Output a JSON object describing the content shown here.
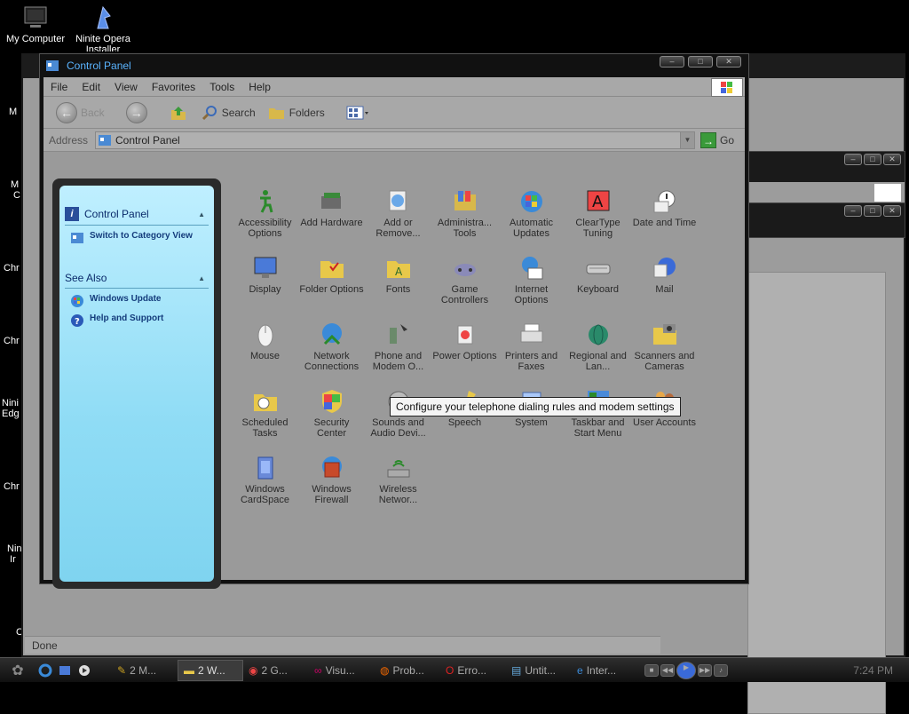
{
  "desktop": {
    "icons": [
      {
        "label": "My Computer"
      },
      {
        "label": "Ninite Opera Installer"
      }
    ],
    "cut_labels": [
      "M",
      "M\nC",
      "Chr",
      "Chr",
      "Nini\nEdg",
      "Chr",
      "Nin\nIr",
      "C"
    ]
  },
  "window": {
    "title": "Control Panel",
    "menu": [
      "File",
      "Edit",
      "View",
      "Favorites",
      "Tools",
      "Help"
    ],
    "toolbar": {
      "back": "Back",
      "search": "Search",
      "folders": "Folders"
    },
    "address": {
      "label": "Address",
      "value": "Control Panel",
      "go": "Go"
    },
    "taskpane": {
      "section1_title": "Control Panel",
      "switch_link": "Switch to Category View",
      "section2_title": "See Also",
      "links": [
        "Windows Update",
        "Help and Support"
      ]
    },
    "items": [
      {
        "label": "Accessibility Options",
        "icon": "accessibility-icon"
      },
      {
        "label": "Add Hardware",
        "icon": "hardware-icon"
      },
      {
        "label": "Add or Remove...",
        "icon": "add-remove-icon"
      },
      {
        "label": "Administra... Tools",
        "icon": "admin-tools-icon"
      },
      {
        "label": "Automatic Updates",
        "icon": "updates-icon"
      },
      {
        "label": "ClearType Tuning",
        "icon": "cleartype-icon"
      },
      {
        "label": "Date and Time",
        "icon": "clock-icon"
      },
      {
        "label": "Display",
        "icon": "display-icon"
      },
      {
        "label": "Folder Options",
        "icon": "folder-options-icon"
      },
      {
        "label": "Fonts",
        "icon": "fonts-icon"
      },
      {
        "label": "Game Controllers",
        "icon": "gamepad-icon"
      },
      {
        "label": "Internet Options",
        "icon": "internet-icon"
      },
      {
        "label": "Keyboard",
        "icon": "keyboard-icon"
      },
      {
        "label": "Mail",
        "icon": "mail-icon"
      },
      {
        "label": "Mouse",
        "icon": "mouse-icon"
      },
      {
        "label": "Network Connections",
        "icon": "network-icon"
      },
      {
        "label": "Phone and Modem O...",
        "icon": "phone-icon"
      },
      {
        "label": "Power Options",
        "icon": "power-icon"
      },
      {
        "label": "Printers and Faxes",
        "icon": "printer-icon"
      },
      {
        "label": "Regional and Lan...",
        "icon": "globe-icon"
      },
      {
        "label": "Scanners and Cameras",
        "icon": "camera-icon"
      },
      {
        "label": "Scheduled Tasks",
        "icon": "tasks-icon"
      },
      {
        "label": "Security Center",
        "icon": "shield-icon"
      },
      {
        "label": "Sounds and Audio Devi...",
        "icon": "speaker-icon"
      },
      {
        "label": "Speech",
        "icon": "speech-icon"
      },
      {
        "label": "System",
        "icon": "system-icon"
      },
      {
        "label": "Taskbar and Start Menu",
        "icon": "taskbar-icon"
      },
      {
        "label": "User Accounts",
        "icon": "users-icon"
      },
      {
        "label": "Windows CardSpace",
        "icon": "cardspace-icon"
      },
      {
        "label": "Windows Firewall",
        "icon": "firewall-icon"
      },
      {
        "label": "Wireless Networ...",
        "icon": "wireless-icon"
      }
    ],
    "tooltip": "Configure your telephone dialing rules and modem settings"
  },
  "back_window": {
    "status": "Done"
  },
  "taskbar": {
    "tasks": [
      {
        "label": "2 M..."
      },
      {
        "label": "2 W..."
      },
      {
        "label": "2 G..."
      },
      {
        "label": "Visu..."
      },
      {
        "label": "Prob..."
      },
      {
        "label": "Erro..."
      },
      {
        "label": "Untit..."
      },
      {
        "label": "Inter..."
      }
    ],
    "clock": "7:24 PM"
  },
  "colors": {
    "title_text": "#5ab4ff",
    "taskpane": "#8fdcf5",
    "panel_bg": "#9a9a9a"
  }
}
